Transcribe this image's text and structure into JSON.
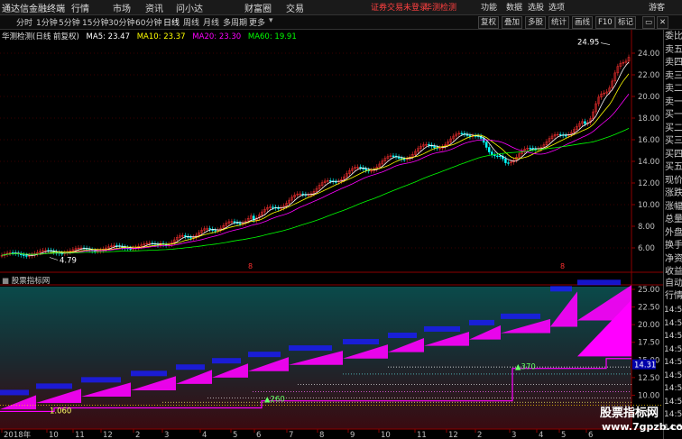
{
  "menubar": {
    "app_title": "通达信金融终端",
    "menus": [
      "行情",
      "市场",
      "资讯",
      "问小达",
      "财富圈",
      "交易"
    ],
    "notice": "证券交易未登录",
    "notice2": "华测检测",
    "right": [
      "功能",
      "数据",
      "选股",
      "选项"
    ],
    "guest": "游客"
  },
  "toolbar": {
    "periods": [
      "分时",
      "1分钟",
      "5分钟",
      "15分钟",
      "30分钟",
      "60分钟",
      "日线",
      "周线",
      "月线",
      "多周期",
      "更多"
    ],
    "active_period": "日线",
    "buttons": [
      "复权",
      "叠加",
      "多股",
      "统计",
      "画线",
      "F10",
      "标记"
    ]
  },
  "main": {
    "title": "华测检测(日线 前复权)",
    "ma5": "MA5: 23.47",
    "ma10": "MA10: 23.37",
    "ma20": "MA20: 23.30",
    "ma60": "MA60: 19.91",
    "price_axis": [
      "24.00",
      "22.00",
      "20.00",
      "18.00",
      "16.00",
      "14.00",
      "12.00",
      "10.00",
      "8.00",
      "6.00"
    ],
    "high_label": "24.95",
    "low_label": "4.79",
    "marker_label": "8"
  },
  "sub": {
    "title": "股票指标网",
    "axis": [
      "25.00",
      "22.50",
      "20.00",
      "17.50",
      "15.00",
      "12.50",
      "10.00",
      "7.50"
    ],
    "current_value": "14.31",
    "labels": [
      "1.060",
      "260",
      "370"
    ]
  },
  "xaxis": {
    "labels": [
      "2018年",
      "10",
      "11",
      "12",
      "2",
      "3",
      "4",
      "5",
      "6",
      "7",
      "8",
      "9",
      "10",
      "11",
      "12",
      "2",
      "3",
      "4",
      "5",
      "6"
    ]
  },
  "right_panel": {
    "items": [
      "委比",
      "卖五",
      "卖四",
      "卖三",
      "卖二",
      "卖一",
      "买一",
      "买二",
      "买三",
      "买四",
      "买五",
      "现价",
      "涨跌",
      "涨幅",
      "总量",
      "外盘",
      "换手",
      "净资",
      "收益"
    ],
    "auto": "自动",
    "quote": "行情",
    "times": [
      "14:5",
      "14:5",
      "14:5",
      "14:5",
      "14:5",
      "14:5",
      "14:5",
      "14:5",
      "14:5",
      "14:5"
    ]
  },
  "watermark": {
    "line1": "股票指标网",
    "line2": "www.7gpzb.com"
  },
  "colors": {
    "ma5": "#ffffff",
    "ma10": "#ffff00",
    "ma20": "#ff00ff",
    "ma60": "#00ff00",
    "up": "#ff3030",
    "down": "#00ffff",
    "magenta": "#ff00ff",
    "blue": "#2020ff"
  }
}
